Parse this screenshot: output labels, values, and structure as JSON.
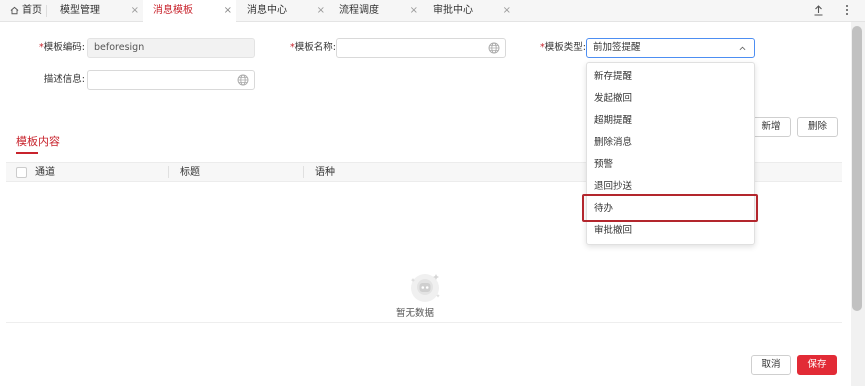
{
  "tabs": [
    {
      "label": "首页",
      "active": false,
      "closable": false
    },
    {
      "label": "模型管理",
      "active": false,
      "closable": true
    },
    {
      "label": "消息模板",
      "active": true,
      "closable": true
    },
    {
      "label": "消息中心",
      "active": false,
      "closable": true
    },
    {
      "label": "流程调度",
      "active": false,
      "closable": true
    },
    {
      "label": "审批中心",
      "active": false,
      "closable": true
    }
  ],
  "tab_close_glyph": "×",
  "toolbar": {
    "upload_icon": "upload-icon",
    "more_icon": "more-vertical-icon"
  },
  "form": {
    "code_label": "模板编码:",
    "code_value": "beforesign",
    "name_label": "模板名称:",
    "name_value": "",
    "type_label": "模板类型:",
    "type_value": "前加签提醒",
    "desc_label": "描述信息:",
    "desc_value": "",
    "required_mark": "*"
  },
  "section": {
    "title": "模板内容"
  },
  "actions": {
    "add": "新增",
    "delete": "删除"
  },
  "table": {
    "columns": [
      "通道",
      "标题",
      "语种"
    ]
  },
  "empty": {
    "text": "暂无数据"
  },
  "dropdown": {
    "options": [
      "新存提醒",
      "发起撤回",
      "超期提醒",
      "删除消息",
      "预警",
      "退回抄送",
      "待办",
      "审批撤回"
    ],
    "highlighted_index": 6
  },
  "footer": {
    "cancel": "取消",
    "save": "保存"
  },
  "colors": {
    "accent": "#c8232c",
    "primary_button": "#e22b36",
    "highlight_border": "#b3262d",
    "focus_border": "#4d8ef2"
  }
}
